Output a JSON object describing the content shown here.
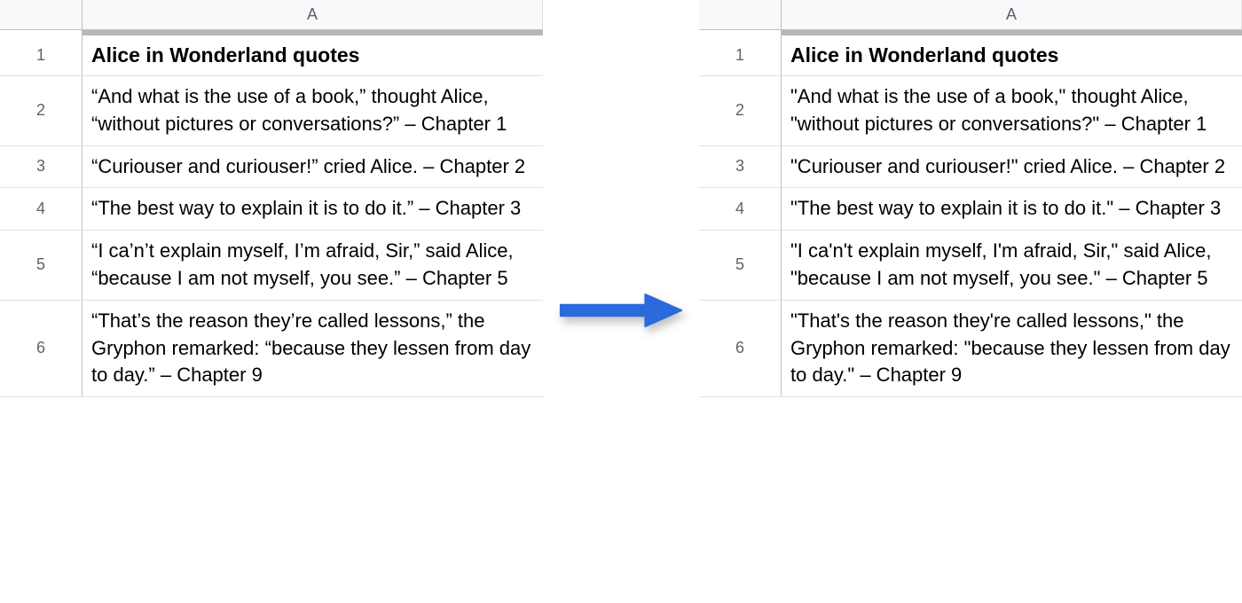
{
  "column_label": "A",
  "left": {
    "title": "Alice in Wonderland quotes",
    "rows": [
      {
        "num": "1"
      },
      {
        "num": "2",
        "text": "“And what is the use of a book,” thought Alice, “without pictures or conversations?” – Chapter 1"
      },
      {
        "num": "3",
        "text": "“Curiouser and curiouser!” cried Alice. – Chapter 2"
      },
      {
        "num": "4",
        "text": "“The best way to explain it is to do it.” – Chapter 3"
      },
      {
        "num": "5",
        "text": "“I ca’n’t explain myself, I’m afraid, Sir,” said Alice, “because I am not myself, you see.” – Chapter 5"
      },
      {
        "num": "6",
        "text": "“That’s the reason they’re called lessons,” the Gryphon remarked: “because they lessen from day to day.” – Chapter 9"
      }
    ]
  },
  "right": {
    "title": "Alice in Wonderland quotes",
    "rows": [
      {
        "num": "1"
      },
      {
        "num": "2",
        "text": "\"And what is the use of a book,\" thought Alice, \"without pictures or conversations?\" – Chapter 1"
      },
      {
        "num": "3",
        "text": "\"Curiouser and curiouser!\" cried Alice. – Chapter 2"
      },
      {
        "num": "4",
        "text": "\"The best way to explain it is to do it.\" – Chapter 3"
      },
      {
        "num": "5",
        "text": "\"I ca'n't explain myself, I'm afraid, Sir,\" said Alice, \"because I am not myself, you see.\" – Chapter 5"
      },
      {
        "num": "6",
        "text": "\"That's the reason they're called lessons,\" the Gryphon remarked: \"because they lessen from day to day.\" – Chapter 9"
      }
    ]
  }
}
